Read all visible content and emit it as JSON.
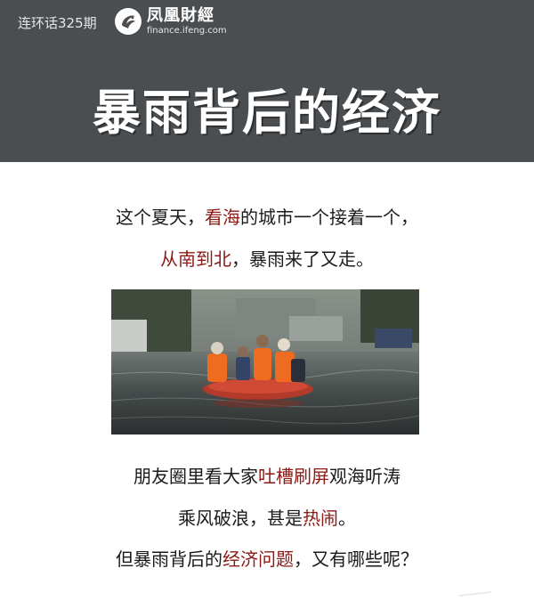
{
  "header": {
    "series": "连环话325期",
    "logo_cn": "凤凰財經",
    "logo_en": "finance.ifeng.com",
    "title": "暴雨背后的经济",
    "background": "#4b4e51"
  },
  "intro": {
    "line1": {
      "a": "这个夏天，",
      "b": "看海",
      "c": "的城市一个接着一个，"
    },
    "line2": {
      "a": "从南到北",
      "b": "，暴雨来了又走。"
    }
  },
  "photo": {
    "icons": [
      "rescue-boat-icon",
      "flooded-street-icon"
    ]
  },
  "outro": {
    "line1": {
      "a": "朋友圈里看大家",
      "b": "吐槽刷屏",
      "c": "观海听涛"
    },
    "line2": {
      "a": "乘风破浪，甚是",
      "b": "热闹",
      "c": "。"
    },
    "line3": {
      "a": "但暴雨背后的",
      "b": "经济问题",
      "c": "，又有哪些呢？"
    }
  },
  "colors": {
    "highlight": "#8b1a16",
    "text": "#1a1a1a"
  }
}
